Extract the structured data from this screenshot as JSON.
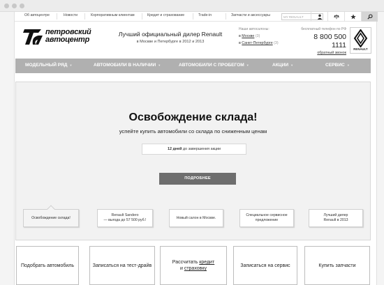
{
  "topnav": {
    "links": [
      "Об автоцентре",
      "Новости",
      "Корпоративным клиентам",
      "Кредит и страхование",
      "Trade-in",
      "Запчасти и аксессуары"
    ],
    "search_placeholder": "MY RENAULT"
  },
  "header": {
    "logo_line1": "петровский",
    "logo_line2": "автоцентр",
    "tagline_line1": "Лучший официальный дилер Renault",
    "tagline_line2": "в Москве и Петербурге в 2012 и 2013",
    "cities_caption": "Наши автосалоны:",
    "city_moscow_pre": "в ",
    "city_moscow": "Москве",
    "city_moscow_count": " (3)",
    "city_spb_pre": "в ",
    "city_spb": "Санкт-Петербурге",
    "city_spb_count": " (3)",
    "phone_caption": "бесплатный телефон по РФ",
    "phone_number": "8 800 500 1111",
    "callback_label": "обратный звонок",
    "brand_label": "RENAULT"
  },
  "menu": {
    "items": [
      "МОДЕЛЬНЫЙ РЯД",
      "АВТОМОБИЛИ В НАЛИЧИИ",
      "АВТОМОБИЛИ С ПРОБЕГОМ",
      "АКЦИИ",
      "СЕРВИС"
    ],
    "caret": "▼"
  },
  "hero": {
    "title": "Освобождение склада!",
    "subtitle": "успейте купить автомобили со склада по сниженным ценам",
    "counter_bold": "12 дней",
    "counter_rest": " до завершения акции",
    "button_label": "ПОДРОБНЕЕ"
  },
  "promos": [
    {
      "line1": "Освобождение склада!",
      "line2": ""
    },
    {
      "line1": "Renault Sandero",
      "line2": "— выгода до 57 500 руб.!"
    },
    {
      "line1": "Новый салон в Москве.",
      "line2": ""
    },
    {
      "line1": "Специальное сервисное",
      "line2": "предложение"
    },
    {
      "line1": "Лучший дилер",
      "line2": "Renault в 2013"
    }
  ],
  "actions": {
    "pick_car": "Подобрать автомобиль",
    "test_drive": "Записаться на тест-драйв",
    "calc_prefix": "Рассчитать ",
    "calc_credit": "кредит",
    "calc_and": "и ",
    "calc_insurance": "страховку",
    "service": "Записаться на сервис",
    "parts": "Купить запчасти"
  },
  "colors": {
    "menu_bg": "#b0b0b0",
    "hero_bg": "#f2f2f2",
    "button_bg": "#6e6e6e"
  }
}
